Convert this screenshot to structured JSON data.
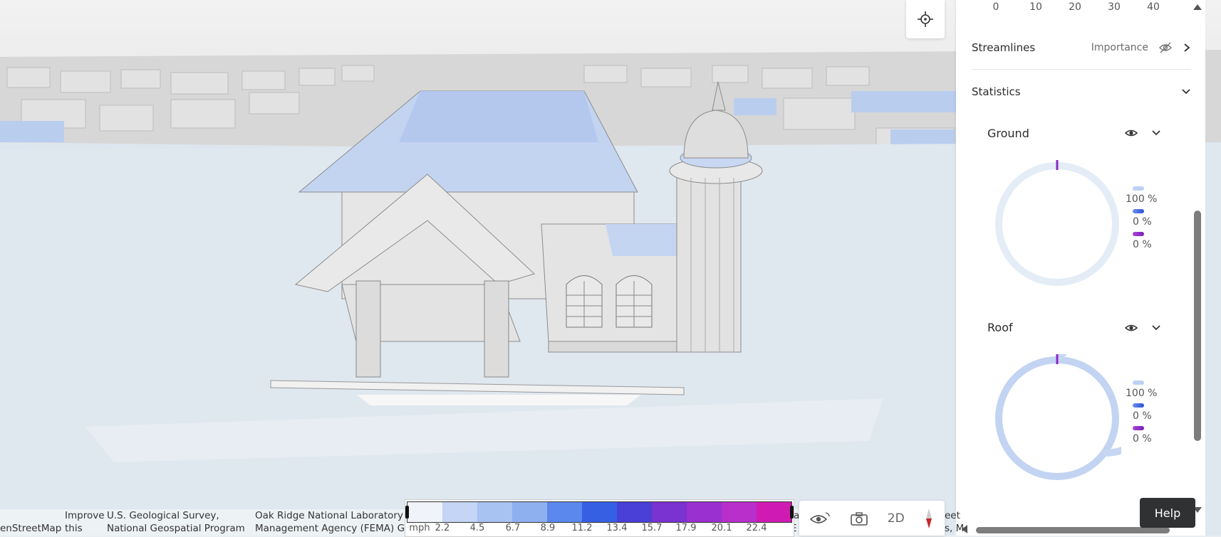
{
  "viewport": {
    "locate_icon": "crosshair-icon"
  },
  "panel": {
    "scale_ticks": [
      "0",
      "10",
      "20",
      "30",
      "40"
    ],
    "streamlines": {
      "label": "Streamlines",
      "mode": "Importance",
      "hidden_icon": "eye-off-icon",
      "open_icon": "chevron-right-icon"
    },
    "statistics": {
      "label": "Statistics",
      "toggle_icon": "chevron-down-icon"
    },
    "ground": {
      "label": "Ground",
      "ring_color": "#e4ecf6",
      "legend": [
        {
          "color": "#bcd0f4",
          "pct": "100 %"
        },
        {
          "color": "#3b64e8",
          "pct": "0 %"
        },
        {
          "color": "#8a2ac5",
          "pct": "0 %"
        }
      ]
    },
    "roof": {
      "label": "Roof",
      "ring_color": "#c3d4f2",
      "legend": [
        {
          "color": "#bcd0f4",
          "pct": "100 %"
        },
        {
          "color": "#3b64e8",
          "pct": "0 %"
        },
        {
          "color": "#8a2ac5",
          "pct": "0 %"
        }
      ]
    }
  },
  "help_label": "Help",
  "attribution": {
    "c1a": "",
    "c1b": "enStreetMap",
    "c2a": "Improve",
    "c2b": "this",
    "c3a": "U.S. Geological Survey,",
    "c3b": "National Geospatial Program",
    "c4a": "Oak Ridge National Laboratory (O",
    "c4b": "Management Agency (FEMA) Geo",
    "c5a": "a",
    "c5b": "E",
    "c6a": "eet",
    "c6b": "s, M"
  },
  "color_legend": {
    "unit": "mph",
    "ticks": [
      "2.2",
      "4.5",
      "6.7",
      "8.9",
      "11.2",
      "13.4",
      "15.7",
      "17.9",
      "20.1",
      "22.4"
    ],
    "colors": [
      "#f0f3f9",
      "#c4d5f5",
      "#a8c2f2",
      "#8fb0ee",
      "#5a88ec",
      "#3560e4",
      "#4a3fd6",
      "#7a32d0",
      "#9a30cf",
      "#b82fcc",
      "#d01bb3"
    ]
  },
  "nav": {
    "view_icon": "eye-rotate-icon",
    "camera_icon": "camera-icon",
    "mode_2d": "2D",
    "compass_icon": "compass-icon"
  }
}
